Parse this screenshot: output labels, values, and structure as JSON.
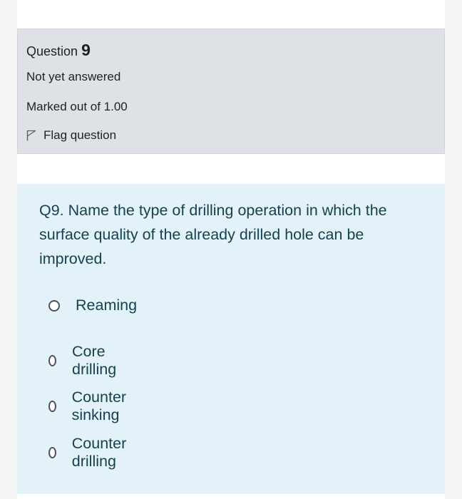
{
  "info": {
    "question_label": "Question",
    "question_number": "9",
    "state": "Not yet answered",
    "grade": "Marked out of 1.00",
    "flag_label": "Flag question"
  },
  "question": {
    "text": "Q9. Name the type of drilling operation in which the surface quality of the already drilled hole can be improved.",
    "options": [
      {
        "label": "Reaming",
        "selected": false
      },
      {
        "label": "Core drilling",
        "selected": false
      },
      {
        "label": "Counter sinking",
        "selected": false
      },
      {
        "label": "Counter drilling",
        "selected": false
      }
    ]
  },
  "icons": {
    "flag": "flag-outline-icon",
    "radio": "radio-unchecked-icon"
  },
  "colors": {
    "info_background": "#dee2e6",
    "content_background": "#e2f2f8",
    "question_text": "#16424f",
    "info_text": "#1d2125"
  }
}
